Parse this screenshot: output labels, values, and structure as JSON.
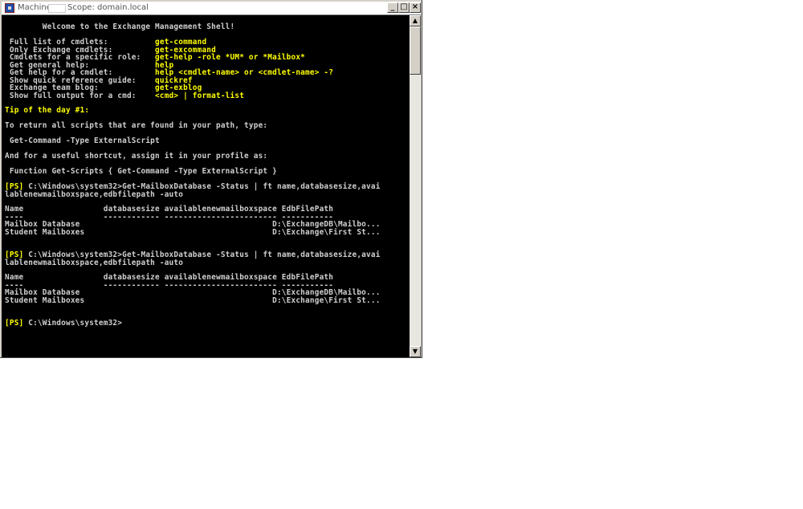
{
  "window": {
    "title_prefix": "Machine",
    "title_suffix": "Scope: domain.local",
    "buttons": {
      "minimize": "_",
      "maximize": "□",
      "close": "×"
    }
  },
  "console": {
    "lines": [
      {
        "text": "        Welcome to the Exchange Management Shell!",
        "color": "#d0d0d0",
        "bold": true
      },
      {
        "text": " Full list of cmdlets:          ",
        "color": "#d0d0d0",
        "bold": true,
        "extra": "get-command",
        "extra_color": "#ffff00"
      },
      {
        "text": " Only Exchange cmdlets:         ",
        "color": "#d0d0d0",
        "bold": true,
        "extra": "get-excommand",
        "extra_color": "#ffff00"
      },
      {
        "text": " Cmdlets for a specific role:   ",
        "color": "#d0d0d0",
        "bold": true,
        "extra": "get-help -role *UM* or *Mailbox*",
        "extra_color": "#ffff00"
      },
      {
        "text": " Get general help:              ",
        "color": "#d0d0d0",
        "bold": true,
        "extra": "help",
        "extra_color": "#ffff00"
      },
      {
        "text": " Get help for a cmdlet:         ",
        "color": "#d0d0d0",
        "bold": true,
        "extra": "help <cmdlet-name> or <cmdlet-name> -?",
        "extra_color": "#ffff00"
      },
      {
        "text": " Show quick reference guide:    ",
        "color": "#d0d0d0",
        "bold": true,
        "extra": "quickref",
        "extra_color": "#ffff00"
      },
      {
        "text": " Exchange team blog:            ",
        "color": "#d0d0d0",
        "bold": true,
        "extra": "get-exblog",
        "extra_color": "#ffff00"
      },
      {
        "text": " Show full output for a cmd:    ",
        "color": "#d0d0d0",
        "bold": true,
        "extra": "<cmd> | format-list",
        "extra_color": "#ffff00"
      },
      {
        "text": "Tip of the day #1:",
        "color": "#ffff00",
        "bold": true
      },
      {
        "text": "To return all scripts that are found in your path, type:",
        "color": "#d0d0d0",
        "bold": true
      },
      {
        "text": " Get-Command -Type ExternalScript",
        "color": "#d0d0d0",
        "bold": true
      },
      {
        "text": "And for a useful shortcut, assign it in your profile as:",
        "color": "#d0d0d0",
        "bold": true
      },
      {
        "text": " Function Get-Scripts { Get-Command -Type ExternalScript }",
        "color": "#d0d0d0",
        "bold": true
      },
      {
        "text": "[PS]",
        "color": "#ffff00",
        "bold": true,
        "extra": " C:\\Windows\\system32>Get-MailboxDatabase -Status | ft name,databasesize,avai",
        "extra_color": "#d0d0d0"
      },
      {
        "text": "lablenewmailboxspace,edbfilepath -auto",
        "color": "#d0d0d0",
        "bold": true
      },
      {
        "text": "Name                 databasesize availablenewmailboxspace EdbFilePath",
        "color": "#d0d0d0",
        "bold": true
      },
      {
        "text": "----                 ------------ ------------------------ -----------",
        "color": "#d0d0d0",
        "bold": true
      },
      {
        "text": "Mailbox Database                                         D:\\ExchangeDB\\Mailbo...",
        "color": "#d0d0d0",
        "bold": true
      },
      {
        "text": "Student Mailboxes                                        D:\\Exchange\\First St...",
        "color": "#d0d0d0",
        "bold": true
      },
      {
        "text": "[PS]",
        "color": "#ffff00",
        "bold": true,
        "extra": " C:\\Windows\\system32>Get-MailboxDatabase -Status | ft name,databasesize,avai",
        "extra_color": "#d0d0d0"
      },
      {
        "text": "lablenewmailboxspace,edbfilepath -auto",
        "color": "#d0d0d0",
        "bold": true
      },
      {
        "text": "Name                 databasesize availablenewmailboxspace EdbFilePath",
        "color": "#d0d0d0",
        "bold": true
      },
      {
        "text": "----                 ------------ ------------------------ -----------",
        "color": "#d0d0d0",
        "bold": true
      },
      {
        "text": "Mailbox Database                                         D:\\ExchangeDB\\Mailbo...",
        "color": "#d0d0d0",
        "bold": true
      },
      {
        "text": "Student Mailboxes                                        D:\\Exchange\\First St...",
        "color": "#d0d0d0",
        "bold": true
      },
      {
        "text": "[PS]",
        "color": "#ffff00",
        "bold": true,
        "extra": " C:\\Windows\\system32>",
        "extra_color": "#d0d0d0"
      }
    ]
  },
  "scrollbar": {
    "up_arrow": "▲",
    "down_arrow": "▼"
  }
}
